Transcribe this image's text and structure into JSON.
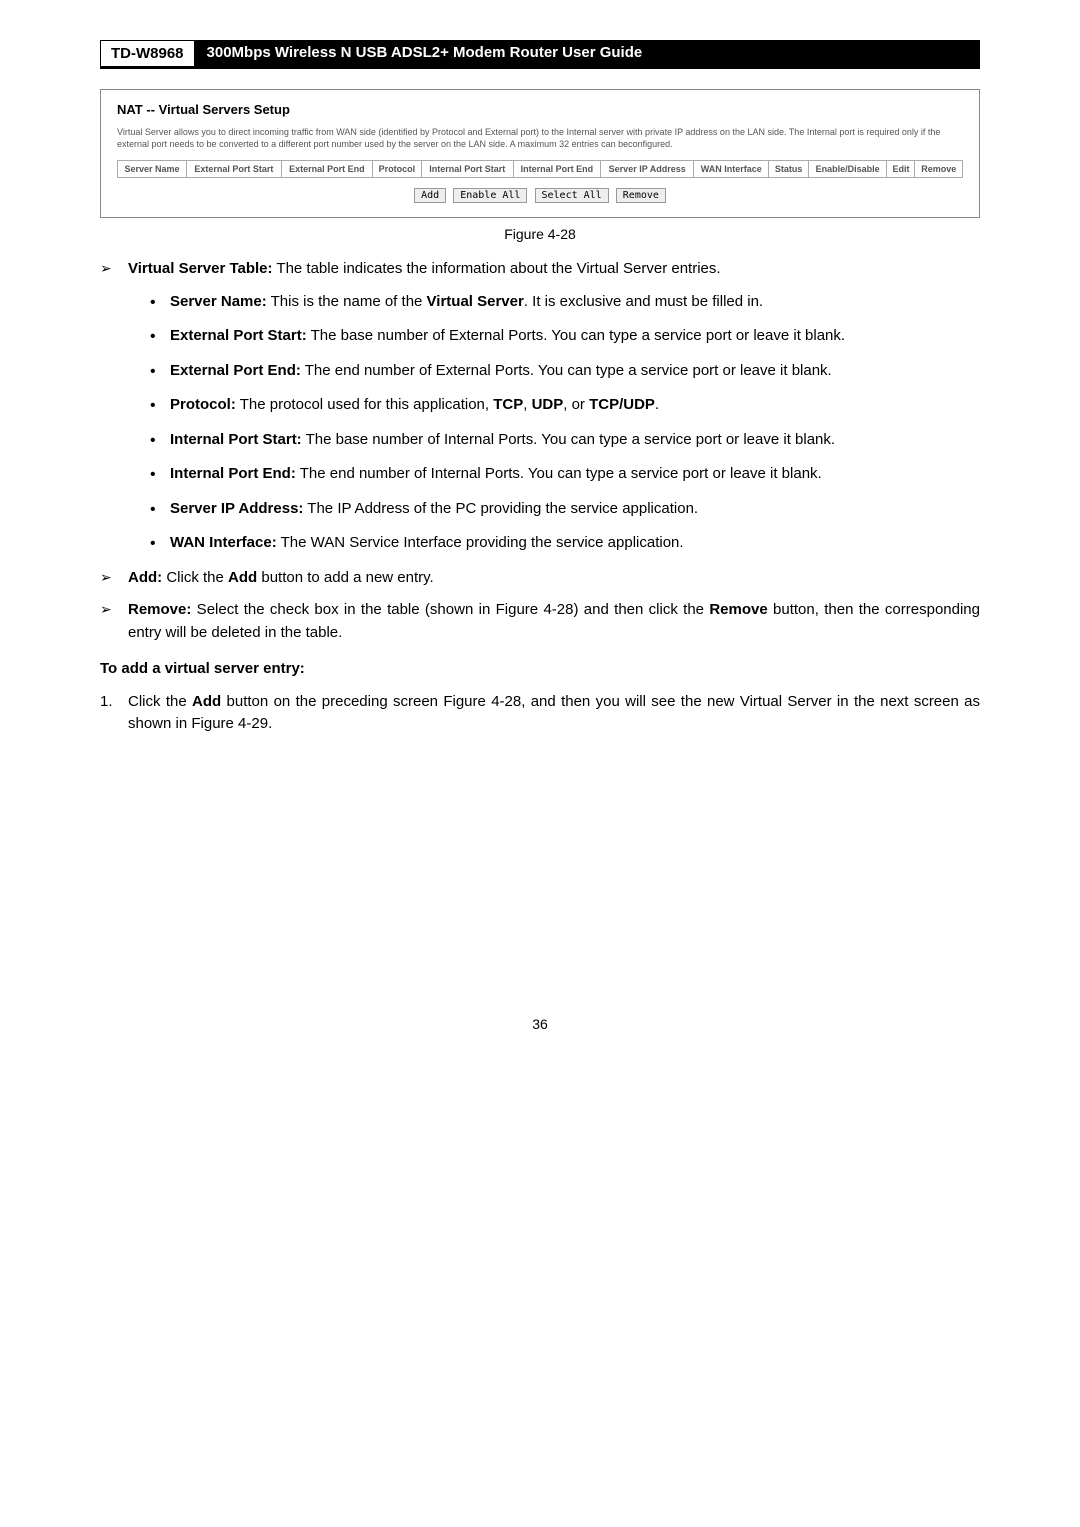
{
  "header": {
    "model": "TD-W8968",
    "title": "300Mbps Wireless N USB ADSL2+ Modem Router User Guide"
  },
  "screenshot": {
    "title": "NAT -- Virtual Servers Setup",
    "desc": "Virtual Server allows you to direct incoming traffic from WAN side (identified by Protocol and External port) to the Internal server with private IP address on the LAN side. The Internal port is required only if the external port needs to be converted to a different port number used by the server on the LAN side. A maximum 32 entries can beconfigured.",
    "cols": [
      "Server Name",
      "External Port Start",
      "External Port End",
      "Protocol",
      "Internal Port Start",
      "Internal Port End",
      "Server IP Address",
      "WAN Interface",
      "Status",
      "Enable/Disable",
      "Edit",
      "Remove"
    ],
    "buttons": {
      "add": "Add",
      "enable": "Enable All",
      "select": "Select All",
      "remove": "Remove"
    }
  },
  "figure_caption": "Figure 4-28",
  "virtual_server_intro_b": "Virtual Server Table:",
  "virtual_server_intro_t": " The table indicates the information about the Virtual Server entries.",
  "bullets": {
    "server_name_b": "Server Name:",
    "server_name_t1": " This is the name of the ",
    "server_name_b2": "Virtual Server",
    "server_name_t2": ". It is exclusive and must be filled in.",
    "ext_start_b": "External Port Start:",
    "ext_start_t": " The base number of External Ports. You can type a service port or leave it blank.",
    "ext_end_b": "External Port End:",
    "ext_end_t": " The end number of External Ports. You can type a service port or leave it blank.",
    "protocol_b": "Protocol:",
    "protocol_t1": " The protocol used for this application, ",
    "protocol_b2": "TCP",
    "protocol_c1": ", ",
    "protocol_b3": "UDP",
    "protocol_c2": ", or ",
    "protocol_b4": "TCP/UDP",
    "protocol_t2": ".",
    "int_start_b": "Internal Port Start:",
    "int_start_t": " The base number of Internal Ports. You can type a service port or leave it blank.",
    "int_end_b": "Internal Port End:",
    "int_end_t": " The end number of Internal Ports. You can type a service port or leave it blank.",
    "server_ip_b": "Server IP Address:",
    "server_ip_t": " The IP Address of the PC providing the service application.",
    "wan_b": "WAN Interface:",
    "wan_t": " The WAN Service Interface providing the service application."
  },
  "add_item_b1": "Add:",
  "add_item_t1": " Click the ",
  "add_item_b2": "Add",
  "add_item_t2": " button to add a new entry.",
  "remove_item_b1": "Remove:",
  "remove_item_t1": " Select the check box in the table (shown in Figure 4-28) and then click the ",
  "remove_item_b2": "Remove",
  "remove_item_t2": " button, then the corresponding entry will be deleted in the table.",
  "to_add_heading": "To add a virtual server entry:",
  "step1_num": "1.",
  "step1_t1": "Click the ",
  "step1_b1": "Add",
  "step1_t2": " button on the preceding screen Figure 4-28, and then you will see the new Virtual Server in the next screen as shown in Figure 4-29.",
  "page_num": "36"
}
